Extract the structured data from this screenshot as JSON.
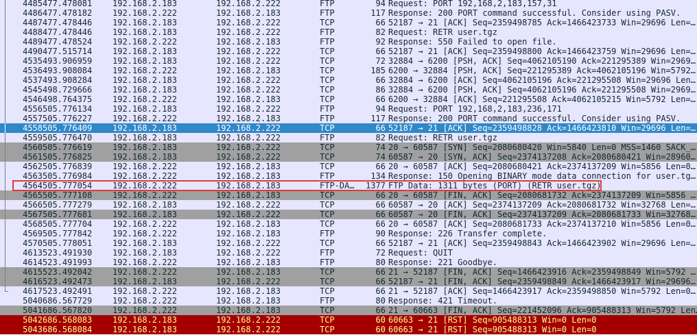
{
  "colors": {
    "ftp": "#e7e6ff",
    "tcp": "#e7e6ff",
    "tcp_bad": "#a0a0a0",
    "selected": "#2f88c8",
    "rst": "#a40000",
    "text_dark": "#12272e",
    "text_rst": "#fffc9c",
    "highlight_box": "#e03a3a"
  },
  "packets": [
    {
      "no": "4485",
      "time": "477.478081",
      "src": "192.168.2.183",
      "dst": "192.168.2.222",
      "proto": "FTP",
      "len": "94",
      "info": "Request: PORT 192,168,2,183,157,31",
      "style": "ftp",
      "tree": "line"
    },
    {
      "no": "4486",
      "time": "477.478182",
      "src": "192.168.2.222",
      "dst": "192.168.2.183",
      "proto": "FTP",
      "len": "117",
      "info": "Response: 200 PORT command successful. Consider using PASV.",
      "style": "ftp",
      "tree": "line"
    },
    {
      "no": "4487",
      "time": "477.478446",
      "src": "192.168.2.183",
      "dst": "192.168.2.222",
      "proto": "TCP",
      "len": "66",
      "info": "52187 → 21 [ACK] Seq=2359498785 Ack=1466423733 Win=29696 Len=…",
      "style": "tcp",
      "tree": "line"
    },
    {
      "no": "4488",
      "time": "477.478446",
      "src": "192.168.2.183",
      "dst": "192.168.2.222",
      "proto": "FTP",
      "len": "82",
      "info": "Request: RETR user.tgz",
      "style": "ftp",
      "tree": "line"
    },
    {
      "no": "4489",
      "time": "477.478524",
      "src": "192.168.2.222",
      "dst": "192.168.2.183",
      "proto": "FTP",
      "len": "92",
      "info": "Response: 550 Failed to open file.",
      "style": "ftp",
      "tree": "line"
    },
    {
      "no": "4490",
      "time": "477.515714",
      "src": "192.168.2.183",
      "dst": "192.168.2.222",
      "proto": "TCP",
      "len": "66",
      "info": "52187 → 21 [ACK] Seq=2359498800 Ack=1466423759 Win=29696 Len=…",
      "style": "tcp",
      "tree": "line"
    },
    {
      "no": "4535",
      "time": "493.906959",
      "src": "192.168.2.183",
      "dst": "192.168.2.222",
      "proto": "TCP",
      "len": "72",
      "info": "32884 → 6200 [PSH, ACK] Seq=4062105190 Ack=221295389 Win=2969…",
      "style": "tcp",
      "tree": "line"
    },
    {
      "no": "4536",
      "time": "493.908084",
      "src": "192.168.2.222",
      "dst": "192.168.2.183",
      "proto": "TCP",
      "len": "185",
      "info": "6200 → 32884 [PSH, ACK] Seq=221295389 Ack=4062105196 Win=5792…",
      "style": "tcp",
      "tree": "line"
    },
    {
      "no": "4537",
      "time": "493.908284",
      "src": "192.168.2.183",
      "dst": "192.168.2.222",
      "proto": "TCP",
      "len": "66",
      "info": "32884 → 6200 [ACK] Seq=4062105196 Ack=221295508 Win=29696 Len…",
      "style": "tcp",
      "tree": "line"
    },
    {
      "no": "4545",
      "time": "498.729666",
      "src": "192.168.2.183",
      "dst": "192.168.2.222",
      "proto": "TCP",
      "len": "86",
      "info": "32884 → 6200 [PSH, ACK] Seq=4062105196 Ack=221295508 Win=2969…",
      "style": "tcp",
      "tree": "line"
    },
    {
      "no": "4546",
      "time": "498.764375",
      "src": "192.168.2.222",
      "dst": "192.168.2.183",
      "proto": "TCP",
      "len": "66",
      "info": "6200 → 32884 [ACK] Seq=221295508 Ack=4062105215 Win=5792 Len=…",
      "style": "tcp",
      "tree": "line"
    },
    {
      "no": "4556",
      "time": "505.776134",
      "src": "192.168.2.183",
      "dst": "192.168.2.222",
      "proto": "FTP",
      "len": "94",
      "info": "Request: PORT 192,168,2,183,236,171",
      "style": "ftp",
      "tree": "line"
    },
    {
      "no": "4557",
      "time": "505.776227",
      "src": "192.168.2.222",
      "dst": "192.168.2.183",
      "proto": "FTP",
      "len": "117",
      "info": "Response: 200 PORT command successful. Consider using PASV.",
      "style": "ftp",
      "tree": "line"
    },
    {
      "no": "4558",
      "time": "505.776409",
      "src": "192.168.2.183",
      "dst": "192.168.2.222",
      "proto": "TCP",
      "len": "66",
      "info": "52187 → 21 [ACK] Seq=2359498828 Ack=1466423810 Win=29696 Len=…",
      "style": "selected",
      "tree": "line"
    },
    {
      "no": "4559",
      "time": "505.776470",
      "src": "192.168.2.183",
      "dst": "192.168.2.222",
      "proto": "FTP",
      "len": "82",
      "info": "Request: RETR user.tgz",
      "style": "ftp",
      "tree": "line"
    },
    {
      "no": "4560",
      "time": "505.776619",
      "src": "192.168.2.183",
      "dst": "192.168.2.222",
      "proto": "TCP",
      "len": "74",
      "info": "20 → 60587 [SYN] Seq=2080680420 Win=5840 Len=0 MSS=1460 SACK_…",
      "style": "tcp_bad",
      "tree": "line"
    },
    {
      "no": "4561",
      "time": "505.776825",
      "src": "192.168.2.183",
      "dst": "192.168.2.222",
      "proto": "TCP",
      "len": "74",
      "info": "60587 → 20 [SYN, ACK] Seq=2374137208 Ack=2080680421 Win=28960…",
      "style": "tcp_bad",
      "tree": "line"
    },
    {
      "no": "4562",
      "time": "505.776839",
      "src": "192.168.2.222",
      "dst": "192.168.2.183",
      "proto": "TCP",
      "len": "66",
      "info": "20 → 60587 [ACK] Seq=2080680421 Ack=2374137209 Win=5856 Len=0…",
      "style": "tcp",
      "tree": "line"
    },
    {
      "no": "4563",
      "time": "505.776984",
      "src": "192.168.2.222",
      "dst": "192.168.2.183",
      "proto": "FTP",
      "len": "134",
      "info": "Response: 150 Opening BINARY mode data connection for user.tg…",
      "style": "ftp",
      "tree": "line"
    },
    {
      "no": "4564",
      "time": "505.777054",
      "src": "192.168.2.222",
      "dst": "192.168.2.183",
      "proto": "FTP-DA…",
      "len": "1377",
      "info": "FTP Data: 1311 bytes (PORT) (RETR user.tgz)",
      "style": "ftp",
      "tree": "line"
    },
    {
      "no": "4565",
      "time": "505.777108",
      "src": "192.168.2.222",
      "dst": "192.168.2.183",
      "proto": "TCP",
      "len": "66",
      "info": "20 → 60587 [FIN, ACK] Seq=2080681732 Ack=2374137209 Win=5856 …",
      "style": "tcp_bad",
      "tree": "line"
    },
    {
      "no": "4566",
      "time": "505.777279",
      "src": "192.168.2.183",
      "dst": "192.168.2.222",
      "proto": "TCP",
      "len": "66",
      "info": "60587 → 20 [ACK] Seq=2374137209 Ack=2080681732 Win=32768 Len=…",
      "style": "tcp",
      "tree": "line"
    },
    {
      "no": "4567",
      "time": "505.777681",
      "src": "192.168.2.183",
      "dst": "192.168.2.222",
      "proto": "TCP",
      "len": "66",
      "info": "60587 → 20 [FIN, ACK] Seq=2374137209 Ack=2080681733 Win=32768…",
      "style": "tcp_bad",
      "tree": "line"
    },
    {
      "no": "4568",
      "time": "505.777704",
      "src": "192.168.2.222",
      "dst": "192.168.2.183",
      "proto": "TCP",
      "len": "66",
      "info": "20 → 60587 [ACK] Seq=2080681733 Ack=2374137210 Win=5856 Len=0…",
      "style": "tcp",
      "tree": "line"
    },
    {
      "no": "4569",
      "time": "505.777842",
      "src": "192.168.2.222",
      "dst": "192.168.2.183",
      "proto": "FTP",
      "len": "90",
      "info": "Response: 226 Transfer complete.",
      "style": "ftp",
      "tree": "line"
    },
    {
      "no": "4570",
      "time": "505.778051",
      "src": "192.168.2.183",
      "dst": "192.168.2.222",
      "proto": "TCP",
      "len": "66",
      "info": "52187 → 21 [ACK] Seq=2359498843 Ack=1466423902 Win=29696 Len=…",
      "style": "tcp",
      "tree": "line"
    },
    {
      "no": "4613",
      "time": "523.491930",
      "src": "192.168.2.183",
      "dst": "192.168.2.222",
      "proto": "FTP",
      "len": "72",
      "info": "Request: QUIT",
      "style": "ftp",
      "tree": "line"
    },
    {
      "no": "4614",
      "time": "523.491993",
      "src": "192.168.2.222",
      "dst": "192.168.2.183",
      "proto": "FTP",
      "len": "80",
      "info": "Response: 221 Goodbye.",
      "style": "ftp",
      "tree": "line"
    },
    {
      "no": "4615",
      "time": "523.492042",
      "src": "192.168.2.222",
      "dst": "192.168.2.183",
      "proto": "TCP",
      "len": "66",
      "info": "21 → 52187 [FIN, ACK] Seq=1466423916 Ack=2359498849 Win=5792 …",
      "style": "tcp_bad",
      "tree": "line"
    },
    {
      "no": "4616",
      "time": "523.492473",
      "src": "192.168.2.183",
      "dst": "192.168.2.222",
      "proto": "TCP",
      "len": "66",
      "info": "52187 → 21 [FIN, ACK] Seq=2359498849 Ack=1466423917 Win=29696…",
      "style": "tcp_bad",
      "tree": "line"
    },
    {
      "no": "4617",
      "time": "523.492491",
      "src": "192.168.2.222",
      "dst": "192.168.2.183",
      "proto": "TCP",
      "len": "66",
      "info": "21 → 52187 [ACK] Seq=1466423917 Ack=2359498850 Win=5792 Len=0…",
      "style": "tcp",
      "tree": "end"
    },
    {
      "no": "5040",
      "time": "686.567729",
      "src": "192.168.2.222",
      "dst": "192.168.2.183",
      "proto": "FTP",
      "len": "80",
      "info": "Response: 421 Timeout.",
      "style": "ftp",
      "tree": "none"
    },
    {
      "no": "5041",
      "time": "686.567820",
      "src": "192.168.2.222",
      "dst": "192.168.2.183",
      "proto": "TCP",
      "len": "66",
      "info": "21 → 60663 [FIN, ACK] Seq=221452096 Ack=905488313 Win=5792 Len…",
      "style": "tcp_bad",
      "tree": "none"
    },
    {
      "no": "5042",
      "time": "686.568083",
      "src": "192.168.2.183",
      "dst": "192.168.2.222",
      "proto": "TCP",
      "len": "60",
      "info": "60663 → 21 [RST] Seq=905488313 Win=0 Len=0",
      "style": "rst",
      "tree": "none"
    },
    {
      "no": "5043",
      "time": "686.568084",
      "src": "192.168.2.183",
      "dst": "192.168.2.222",
      "proto": "TCP",
      "len": "60",
      "info": "60663 → 21 [RST] Seq=905488313 Win=0 Len=0",
      "style": "rst",
      "tree": "none"
    }
  ],
  "highlighted_packet": "4564"
}
